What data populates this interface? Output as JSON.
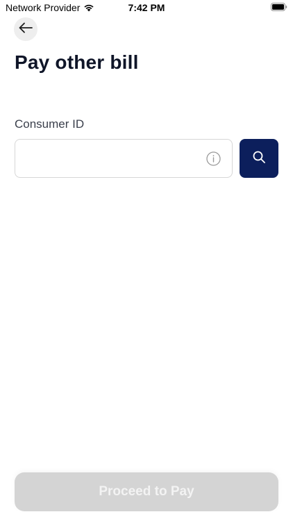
{
  "status_bar": {
    "carrier": "Network Provider",
    "time": "7:42 PM",
    "wifi_icon": "wifi-icon",
    "battery_icon": "battery-icon"
  },
  "header": {
    "back_icon": "arrow-left-icon",
    "title": "Pay other bill"
  },
  "form": {
    "consumer_label": "Consumer ID",
    "consumer_value": "",
    "consumer_placeholder": "",
    "info_icon": "info-icon",
    "search_icon": "search-icon"
  },
  "footer": {
    "proceed_label": "Proceed to Pay",
    "proceed_enabled": false
  },
  "colors": {
    "primary": "#0c1f5c",
    "title": "#0f1528",
    "disabled_button": "#d4d4d4"
  }
}
